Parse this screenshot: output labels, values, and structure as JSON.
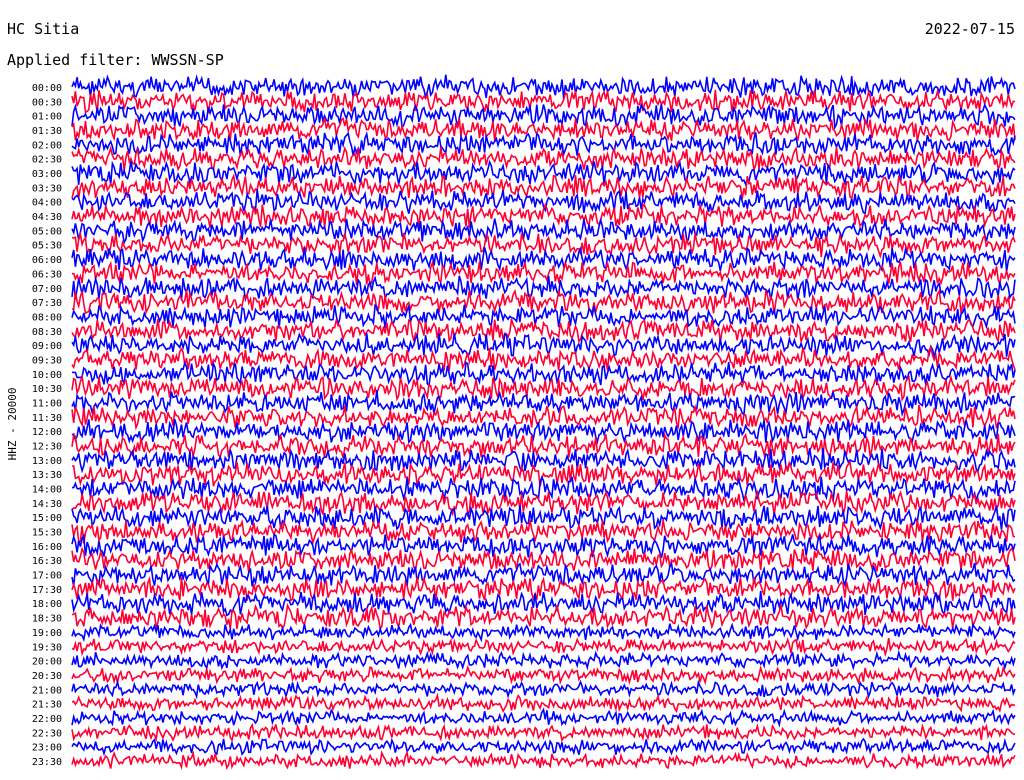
{
  "header": {
    "station": "HC Sitia",
    "filter": "Applied filter: WWSSN-SP",
    "date": "2022-07-15"
  },
  "chart_data": {
    "type": "line",
    "title": "HC Sitia",
    "ylabel": "HHZ - 20000",
    "y_ticks": [
      "00:00",
      "00:30",
      "01:00",
      "01:30",
      "02:00",
      "02:30",
      "03:00",
      "03:30",
      "04:00",
      "04:30",
      "05:00",
      "05:30",
      "06:00",
      "06:30",
      "07:00",
      "07:30",
      "08:00",
      "08:30",
      "09:00",
      "09:30",
      "10:00",
      "10:30",
      "11:00",
      "11:30",
      "12:00",
      "12:30",
      "13:00",
      "13:30",
      "14:00",
      "14:30",
      "15:00",
      "15:30",
      "16:00",
      "16:30",
      "17:00",
      "17:30",
      "18:00",
      "18:30",
      "19:00",
      "19:30",
      "20:00",
      "20:30",
      "21:00",
      "21:30",
      "22:00",
      "22:30",
      "23:00",
      "23:30"
    ],
    "series_colors": [
      "#0000ff",
      "#ff0033"
    ],
    "grid": false,
    "legend": "none"
  }
}
